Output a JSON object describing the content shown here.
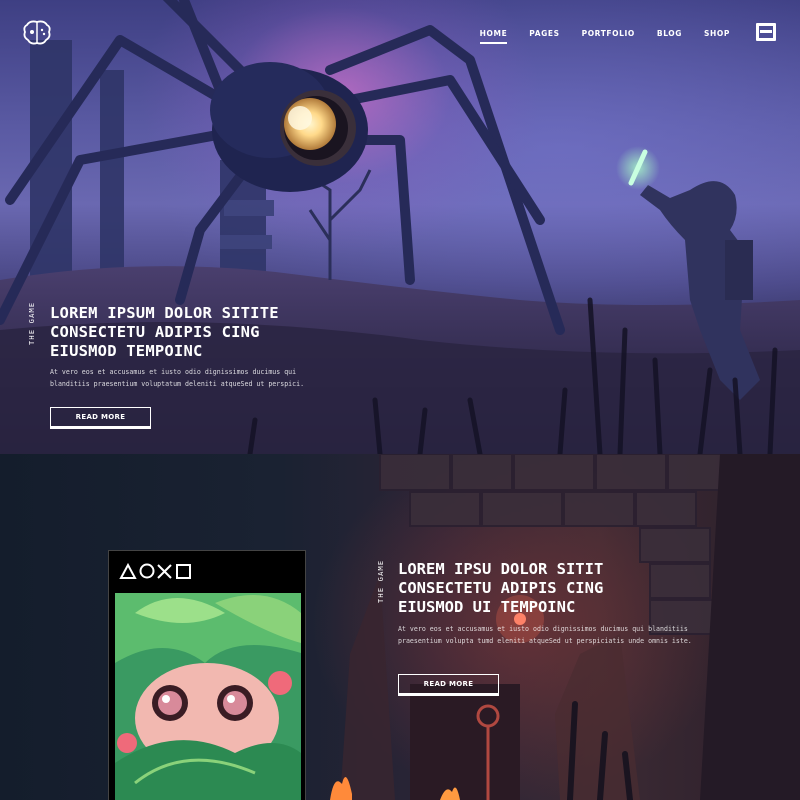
{
  "header": {
    "logo_icon": "brain-gamepad-icon",
    "nav": [
      {
        "label": "HOME",
        "active": true
      },
      {
        "label": "PAGES",
        "active": false
      },
      {
        "label": "PORTFOLIO",
        "active": false
      },
      {
        "label": "BLOG",
        "active": false
      },
      {
        "label": "SHOP",
        "active": false
      }
    ],
    "menu_icon": "hamburger-menu-icon"
  },
  "hero": {
    "tag": "THE GAME",
    "title_lines": [
      "LOREM IPSUM DOLOR SITITE",
      "CONSECTETU ADIPIS CING",
      "EIUSMOD TEMPOINC"
    ],
    "text": "At vero eos et accusamus et iusto odio dignissimos ducimus qui blanditiis praesentium voluptatum deleniti atqueSed ut perspici.",
    "button": "READ MORE"
  },
  "feature": {
    "phone_symbols": [
      "triangle-icon",
      "circle-icon",
      "cross-icon",
      "square-icon"
    ],
    "tag": "THE GAME",
    "title_lines": [
      "LOREM IPSU DOLOR SITIT",
      "CONSECTETU ADIPIS CING",
      "EIUSMOD UI TEMPOINC"
    ],
    "text": "At vero eos et accusamus et iusto odio dignissimos ducimus qui blanditiis praesentium volupta tumd eleniti atqueSed ut perspiciatis unde omnis iste.",
    "button": "READ MORE"
  },
  "colors": {
    "accent": "#ffffff",
    "glow_green": "#9ff5c0",
    "eye_glow": "#ffe3a0"
  }
}
